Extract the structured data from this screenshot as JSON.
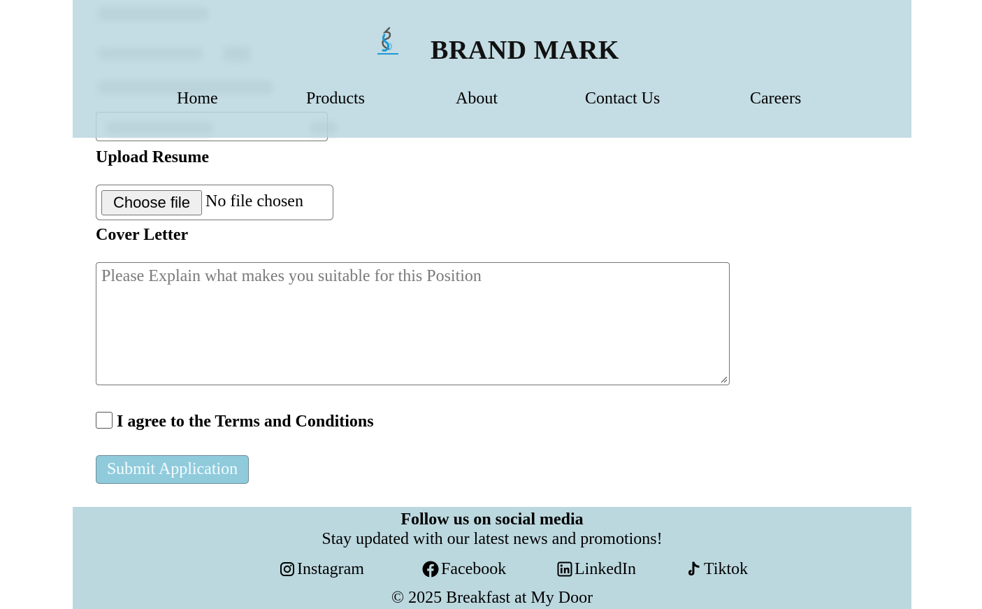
{
  "header": {
    "brand": "BRAND MARK",
    "logo_icon": "brandmark-logo-icon",
    "nav": [
      "Home",
      "Products",
      "About",
      "Contact Us",
      "Careers"
    ]
  },
  "form": {
    "resume_label": "Upload Resume",
    "file_button": "Choose file",
    "file_status": "No file chosen",
    "cover_label": "Cover Letter",
    "cover_placeholder": "Please Explain what makes you suitable for this Position",
    "terms_label": "I agree to the Terms and Conditions",
    "terms_checked": false,
    "submit_label": "Submit Application"
  },
  "footer": {
    "title": "Follow us on social media",
    "subtitle": "Stay updated with our latest news and promotions!",
    "social": [
      {
        "label": "Instagram",
        "icon": "instagram-icon"
      },
      {
        "label": "Facebook",
        "icon": "facebook-icon"
      },
      {
        "label": "LinkedIn",
        "icon": "linkedin-icon"
      },
      {
        "label": "Tiktok",
        "icon": "tiktok-icon"
      }
    ],
    "copyright": "© 2025 Breakfast at My Door"
  },
  "colors": {
    "header_bg": "#bad6de",
    "footer_bg": "#bcd8df",
    "submit_bg": "#90cbdc",
    "logo_blue": "#1a9ad6"
  }
}
